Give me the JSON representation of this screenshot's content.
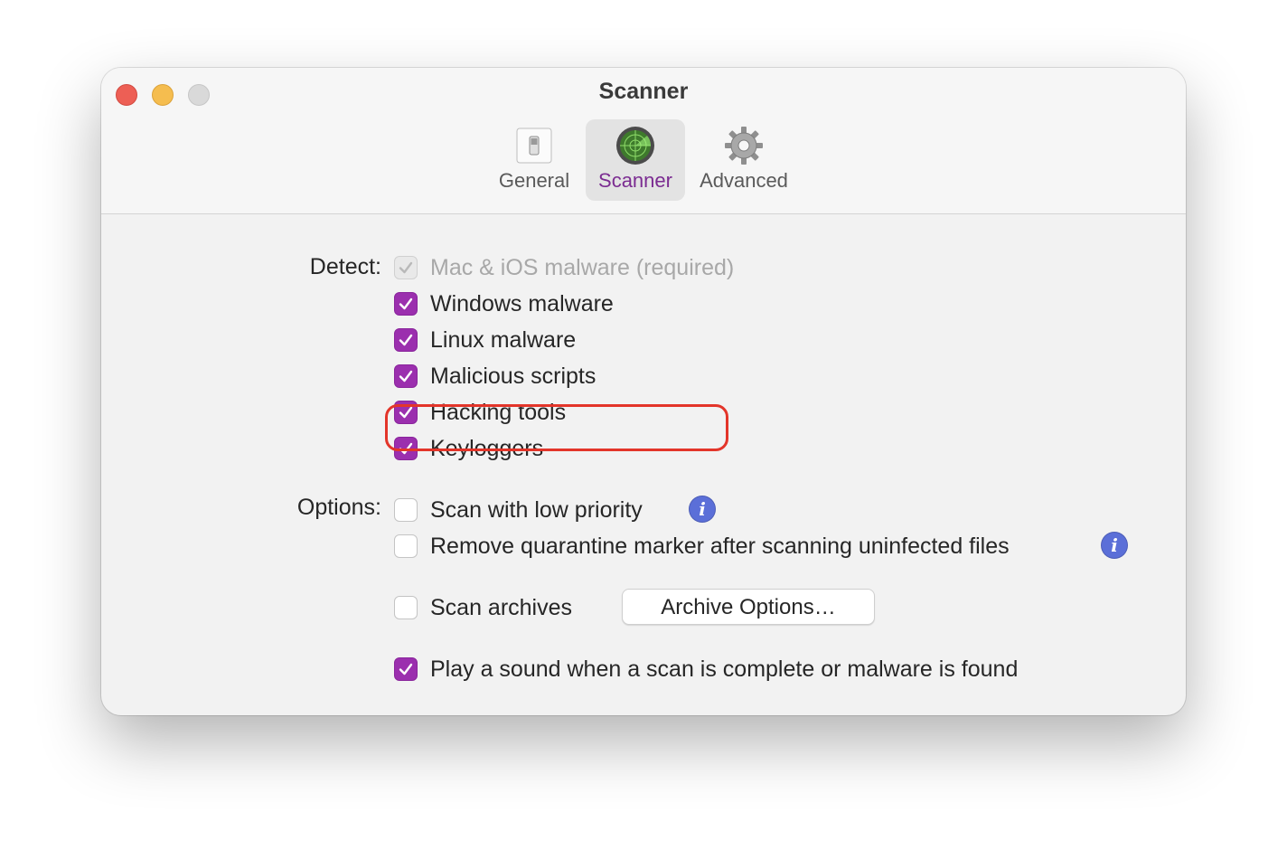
{
  "window": {
    "title": "Scanner"
  },
  "toolbar": {
    "tabs": [
      {
        "label": "General",
        "icon": "switch-icon",
        "active": false
      },
      {
        "label": "Scanner",
        "icon": "radar-icon",
        "active": true
      },
      {
        "label": "Advanced",
        "icon": "gear-icon",
        "active": false
      }
    ]
  },
  "detect": {
    "label": "Detect:",
    "items": [
      {
        "label": "Mac & iOS malware (required)",
        "checked": true,
        "disabled": true
      },
      {
        "label": "Windows malware",
        "checked": true,
        "disabled": false
      },
      {
        "label": "Linux malware",
        "checked": true,
        "disabled": false
      },
      {
        "label": "Malicious scripts",
        "checked": true,
        "disabled": false
      },
      {
        "label": "Hacking tools",
        "checked": true,
        "disabled": false
      },
      {
        "label": "Keyloggers",
        "checked": true,
        "disabled": false
      }
    ]
  },
  "options": {
    "label": "Options:",
    "items": [
      {
        "label": "Scan with low priority",
        "checked": false
      },
      {
        "label": "Remove quarantine marker after scanning uninfected files",
        "checked": false
      },
      {
        "label": "Scan archives",
        "checked": false
      },
      {
        "label": "Play a sound when a scan is complete or malware is found",
        "checked": true
      }
    ],
    "archive_button": "Archive Options…",
    "info_glyph": "i"
  },
  "colors": {
    "accent": "#9b2fae",
    "highlight": "#e3352a",
    "info": "#5b6fd8"
  }
}
